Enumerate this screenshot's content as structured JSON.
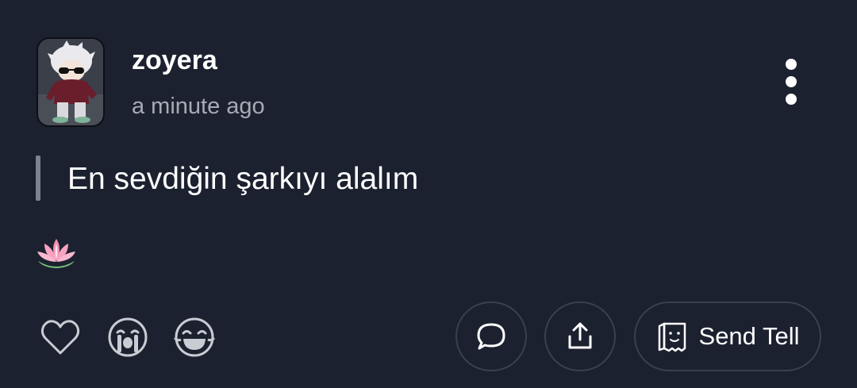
{
  "post": {
    "username": "zoyera",
    "timestamp": "a minute ago",
    "text": "En sevdiğin şarkıyı alalım",
    "emoji": "🪷"
  },
  "actions": {
    "send_tell_label": "Send Tell"
  },
  "icons": {
    "more": "vertical-dots-icon",
    "like": "heart-outline-icon",
    "cry": "crying-face-icon",
    "laugh": "laughing-face-icon",
    "comment": "speech-bubble-icon",
    "share": "share-upload-icon",
    "tell": "tell-ghost-icon"
  },
  "colors": {
    "background": "#1c2130",
    "primary_text": "#ffffff",
    "secondary_text": "#a7abb5",
    "quote_bar": "#7d8290",
    "button_border": "#3a4050",
    "icon": "#c9ccd3"
  }
}
